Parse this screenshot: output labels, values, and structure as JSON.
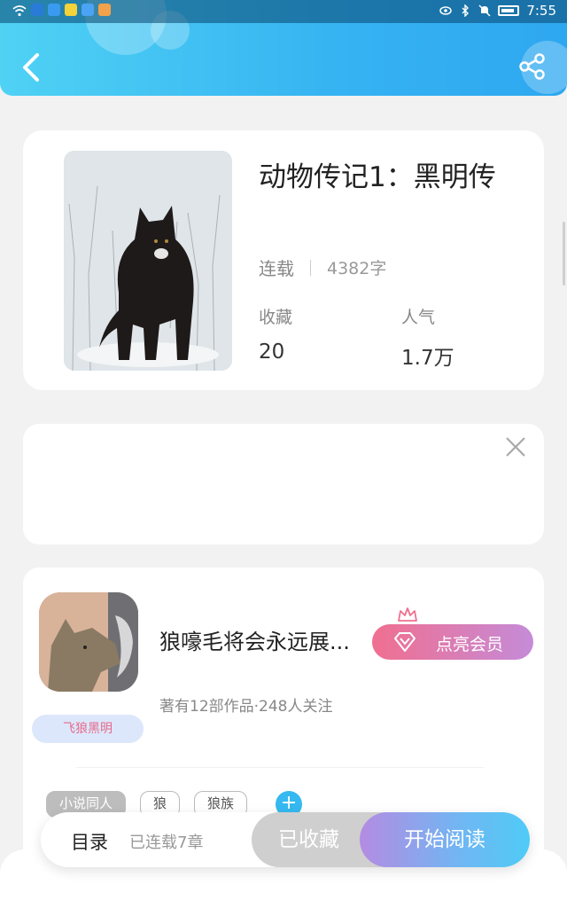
{
  "status_bar": {
    "time": "7:55",
    "icons": [
      "wifi-icon",
      "app-icon",
      "app-icon",
      "app-icon",
      "app-icon",
      "app-icon",
      "eye-icon",
      "bluetooth-icon",
      "mute-icon",
      "battery-icon"
    ]
  },
  "header": {
    "back_icon": "chevron-left-icon",
    "share_icon": "share-icon",
    "accent": "#35b3f2"
  },
  "book": {
    "title": "动物传记1：黑明传",
    "status": "连载",
    "word_count": "4382字",
    "stats": [
      {
        "label": "收藏",
        "value": "20"
      },
      {
        "label": "人气",
        "value": "1.7万"
      }
    ]
  },
  "ad": {
    "close_icon": "close-icon"
  },
  "author": {
    "name": "狼嚎毛将会永远展...",
    "tag": "飞狼黑明",
    "summary": "著有12部作品·248人关注",
    "vip_label": "点亮会员",
    "vip_color": "#f06f90"
  },
  "tags": [
    "小说同人",
    "狼",
    "狼族"
  ],
  "bottom_bar": {
    "toc_label": "目录",
    "chapters_label": "已连载7章",
    "favorited_label": "已收藏",
    "read_label": "开始阅读"
  }
}
